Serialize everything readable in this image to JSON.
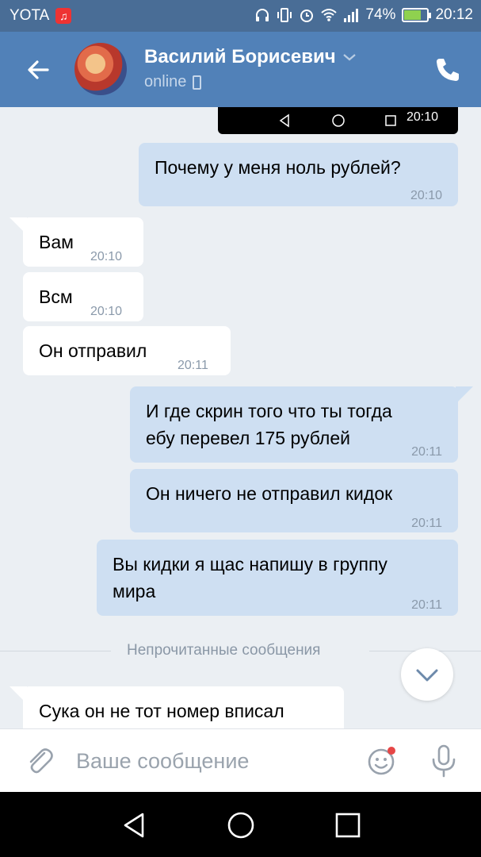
{
  "status_bar": {
    "carrier": "YOTA",
    "battery": "74%",
    "time": "20:12"
  },
  "header": {
    "contact_name": "Василий Борисевич",
    "status": "online"
  },
  "screenshot_strip": {
    "time": "20:10"
  },
  "messages": [
    {
      "dir": "out",
      "text": "Почему у меня ноль рублей?",
      "time": "20:10"
    },
    {
      "dir": "in",
      "text": "Вам",
      "time": "20:10"
    },
    {
      "dir": "in",
      "text": "Всм",
      "time": "20:10"
    },
    {
      "dir": "in",
      "text": "Он отправил",
      "time": "20:11"
    },
    {
      "dir": "out",
      "line1": "И где скрин того что ты тогда",
      "line2": "ебу перевел 175 рублей",
      "time": "20:11"
    },
    {
      "dir": "out",
      "text": "Он ничего не отправил кидок",
      "time": "20:11"
    },
    {
      "dir": "out",
      "line1": "Вы кидки я щас напишу в группу",
      "line2": "мира",
      "time": "20:11"
    },
    {
      "dir": "in",
      "text": "Сука он не тот номер вписал"
    }
  ],
  "divider": {
    "label": "Непрочитанные сообщения"
  },
  "composer": {
    "placeholder": "Ваше сообщение"
  },
  "colors": {
    "header_bg": "#5181b8",
    "statusbar_bg": "#496d96",
    "chat_bg": "#ebeff3",
    "outgoing_bubble": "#cedff2",
    "incoming_bubble": "#ffffff",
    "unread_dot": "#e64646"
  },
  "icons": [
    "music-icon",
    "headphones-icon",
    "vibrate-icon",
    "alarm-icon",
    "wifi-icon",
    "signal-icon",
    "battery-icon",
    "back-arrow-icon",
    "chevron-down-icon",
    "mobile-icon",
    "phone-icon",
    "attach-icon",
    "emoji-icon",
    "mic-icon",
    "nav-back-icon",
    "nav-home-icon",
    "nav-recents-icon"
  ]
}
